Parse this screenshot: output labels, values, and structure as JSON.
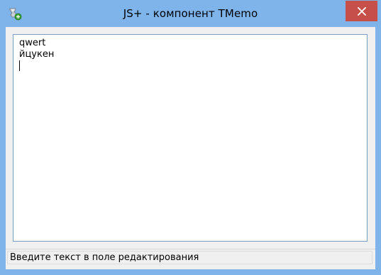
{
  "window": {
    "title": "JS+ - компонент TMemo",
    "close_glyph": "✕"
  },
  "colors": {
    "titlebar": "#7eb4ea",
    "close_button": "#c74f4a",
    "client_background": "#f0f0f0",
    "memo_border": "#7a9cc5"
  },
  "icons": {
    "app": "app-icon",
    "close": "close-icon"
  },
  "memo": {
    "lines": [
      "qwert",
      "йцукен",
      ""
    ]
  },
  "statusbar": {
    "text": "Введите текст в поле редактирования"
  }
}
